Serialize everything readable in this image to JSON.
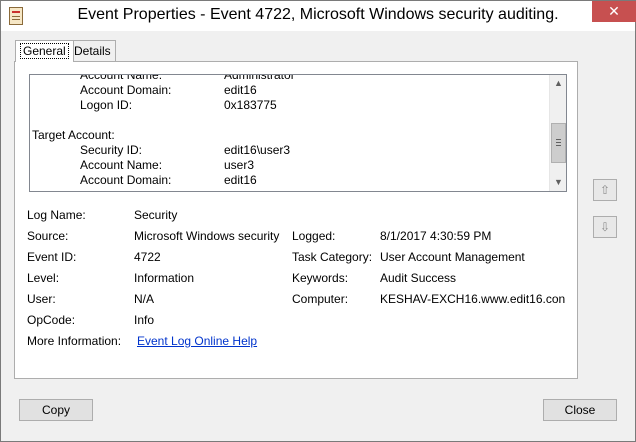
{
  "window": {
    "title": "Event Properties - Event 4722, Microsoft Windows security auditing.",
    "close_label": "✕"
  },
  "tabs": [
    {
      "label": "General",
      "active": true
    },
    {
      "label": "Details",
      "active": false
    }
  ],
  "description": {
    "partial_top": {
      "key": "Account Name:",
      "value": "Administrator"
    },
    "lines": [
      {
        "key": "Account Domain:",
        "value": "edit16"
      },
      {
        "key": "Logon ID:",
        "value": "0x183775"
      }
    ],
    "section_header": "Target Account:",
    "target_lines": [
      {
        "key": "Security ID:",
        "value": "edit16\\user3"
      },
      {
        "key": "Account Name:",
        "value": "user3"
      },
      {
        "key": "Account Domain:",
        "value": "edit16"
      }
    ]
  },
  "fields": {
    "log_name": {
      "label": "Log Name:",
      "value": "Security"
    },
    "source": {
      "label": "Source:",
      "value": "Microsoft Windows security"
    },
    "logged": {
      "label": "Logged:",
      "value": "8/1/2017 4:30:59 PM"
    },
    "event_id": {
      "label": "Event ID:",
      "value": "4722"
    },
    "task_category": {
      "label": "Task Category:",
      "value": "User Account Management"
    },
    "level": {
      "label": "Level:",
      "value": "Information"
    },
    "keywords": {
      "label": "Keywords:",
      "value": "Audit Success"
    },
    "user": {
      "label": "User:",
      "value": "N/A"
    },
    "computer": {
      "label": "Computer:",
      "value": "KESHAV-EXCH16.www.edit16.con"
    },
    "opcode": {
      "label": "OpCode:",
      "value": "Info"
    },
    "more_info": {
      "label": "More Information:",
      "link": "Event Log Online Help"
    }
  },
  "buttons": {
    "copy": "Copy",
    "close": "Close",
    "up_arrow": "⇧",
    "down_arrow": "⇩"
  },
  "colors": {
    "link": "#0033cc",
    "close_button": "#c75050",
    "dialog_bg": "#f0f0f0"
  }
}
